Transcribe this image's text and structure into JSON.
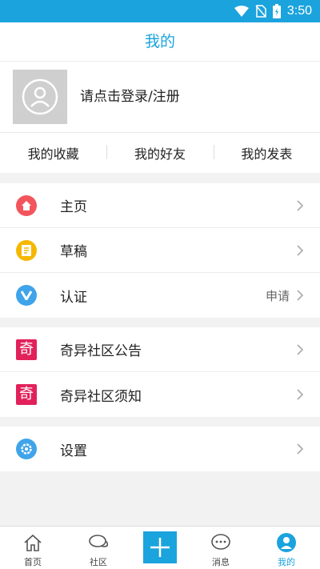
{
  "status_bar": {
    "time": "3:50",
    "icons": [
      "wifi-icon",
      "no-sim-icon",
      "battery-charging-icon"
    ]
  },
  "header": {
    "title": "我的"
  },
  "profile": {
    "login_prompt": "请点击登录/注册",
    "avatar_icon": "user-avatar-icon"
  },
  "quick_links": [
    {
      "label": "我的收藏"
    },
    {
      "label": "我的好友"
    },
    {
      "label": "我的发表"
    }
  ],
  "menu_group_1": [
    {
      "label": "主页",
      "icon": "home-icon",
      "color": "#f2555c"
    },
    {
      "label": "草稿",
      "icon": "draft-icon",
      "color": "#f5b800"
    },
    {
      "label": "认证",
      "icon": "verify-v-icon",
      "color": "#3fa4ea",
      "extra": "申请"
    }
  ],
  "menu_group_2": [
    {
      "label": "奇异社区公告",
      "icon": "qi-logo-icon",
      "badge_char": "奇",
      "color": "#e2215b"
    },
    {
      "label": "奇异社区须知",
      "icon": "qi-logo-icon",
      "badge_char": "奇",
      "color": "#e2215b"
    }
  ],
  "menu_group_3": [
    {
      "label": "设置",
      "icon": "gear-icon",
      "color": "#3fa4ea"
    }
  ],
  "tab_bar": {
    "tabs": [
      {
        "label": "首页",
        "icon": "home-outline-icon"
      },
      {
        "label": "社区",
        "icon": "chat-bubbles-icon"
      },
      {
        "label": "消息",
        "icon": "message-icon"
      },
      {
        "label": "我的",
        "icon": "profile-icon",
        "active": true
      }
    ],
    "add_icon": "plus-icon"
  },
  "colors": {
    "accent": "#1ba3dd",
    "background": "#f2f2f2"
  }
}
